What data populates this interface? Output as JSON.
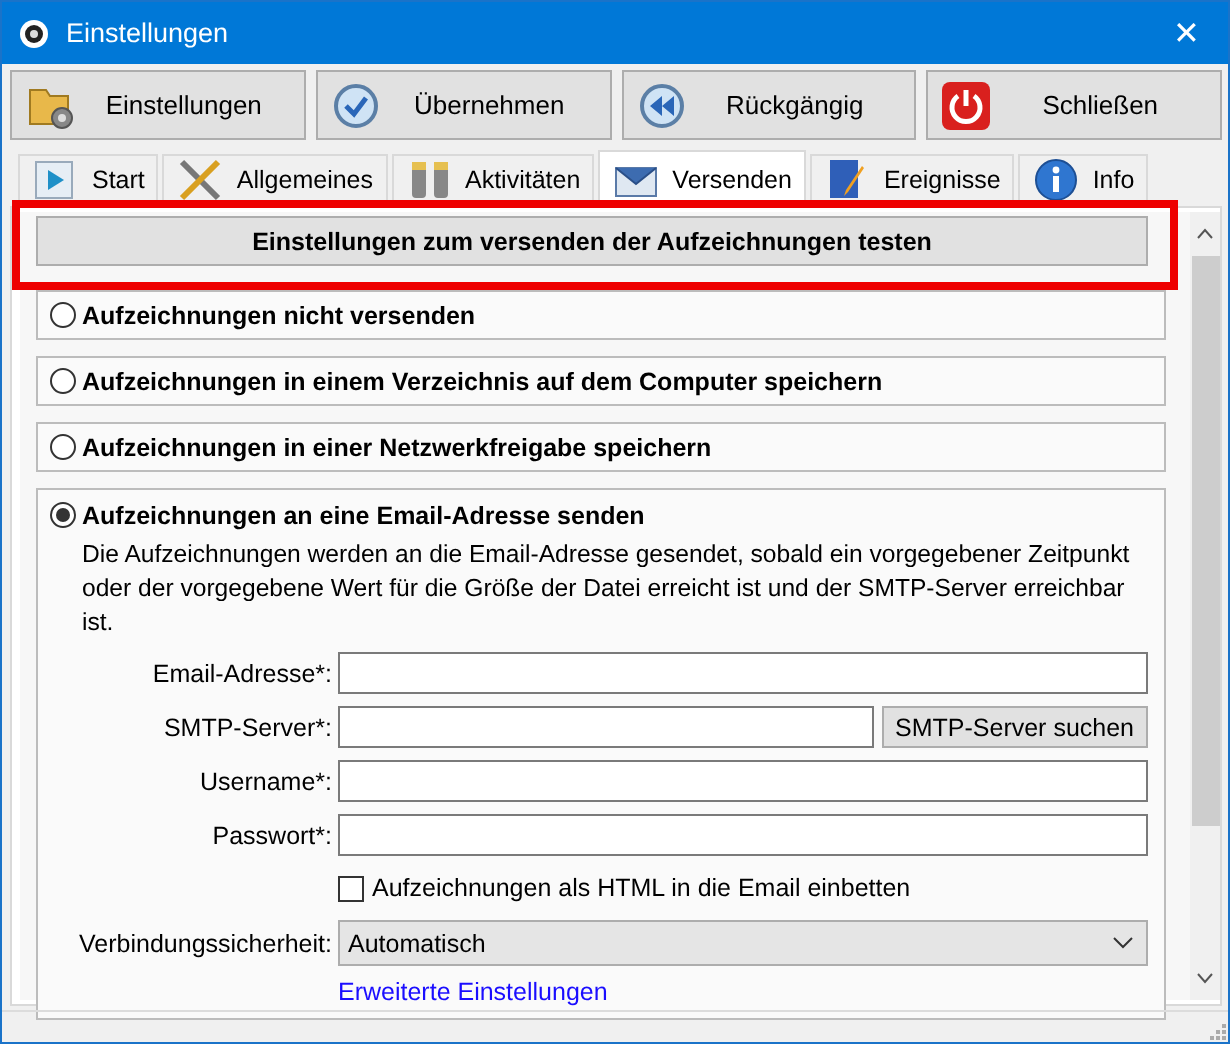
{
  "window": {
    "title": "Einstellungen",
    "close": "✕"
  },
  "toolbar": [
    {
      "label": "Einstellungen"
    },
    {
      "label": "Übernehmen"
    },
    {
      "label": "Rückgängig"
    },
    {
      "label": "Schließen"
    }
  ],
  "tabs": [
    {
      "label": "Start",
      "selected": false
    },
    {
      "label": "Allgemeines",
      "selected": false
    },
    {
      "label": "Aktivitäten",
      "selected": false
    },
    {
      "label": "Versenden",
      "selected": true
    },
    {
      "label": "Ereignisse",
      "selected": false
    },
    {
      "label": "Info",
      "selected": false
    }
  ],
  "test_button": "Einstellungen zum versenden der Aufzeichnungen testen",
  "options": [
    {
      "label": "Aufzeichnungen nicht versenden",
      "selected": false
    },
    {
      "label": "Aufzeichnungen in einem Verzeichnis auf dem Computer speichern",
      "selected": false
    },
    {
      "label": "Aufzeichnungen in einer Netzwerkfreigabe speichern",
      "selected": false
    },
    {
      "label": "Aufzeichnungen an eine Email-Adresse senden",
      "selected": true
    }
  ],
  "email_form": {
    "description": "Die Aufzeichnungen werden an die Email-Adresse gesendet, sobald ein vorgegebener Zeitpunkt oder der vorgegebene Wert für die Größe der Datei erreicht ist und der SMTP-Server erreichbar ist.",
    "fields": [
      {
        "label": "Email-Adresse*:"
      },
      {
        "label": "SMTP-Server*:",
        "button": "SMTP-Server suchen"
      },
      {
        "label": "Username*:"
      },
      {
        "label": "Passwort*:"
      }
    ],
    "checkbox": {
      "label": "Aufzeichnungen als HTML in die Email einbetten",
      "checked": false
    },
    "security": {
      "label": "Verbindungssicherheit:",
      "value": "Automatisch"
    },
    "link": "Erweiterte Einstellungen"
  }
}
